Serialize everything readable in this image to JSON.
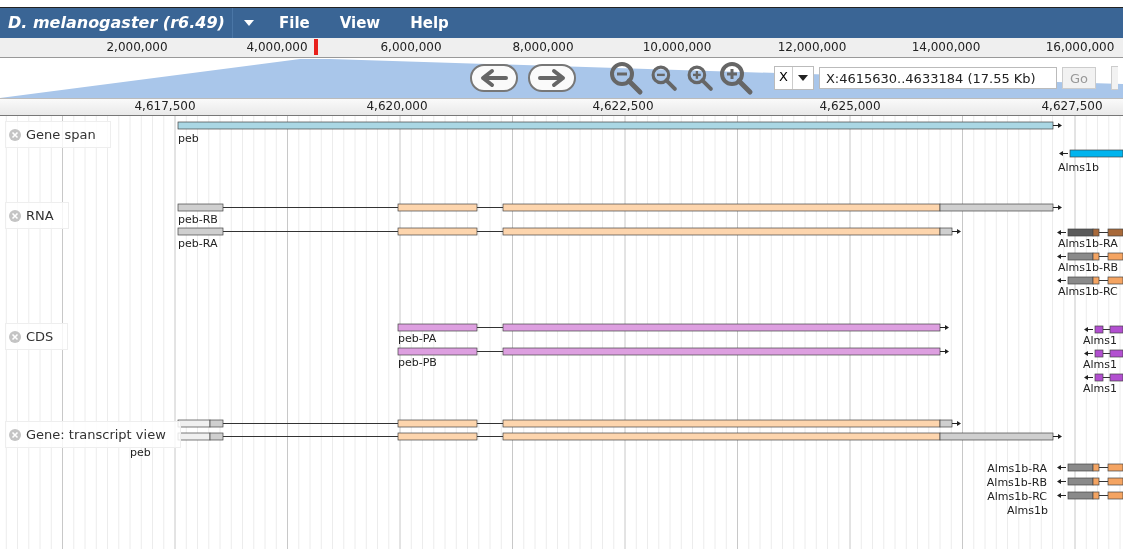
{
  "menu_bar": {
    "title": "D. melanogaster (r6.49)",
    "menus": [
      "File",
      "View",
      "Help"
    ]
  },
  "overview": {
    "ticks": [
      "2,000,000",
      "4,000,000",
      "6,000,000",
      "8,000,000",
      "10,000,000",
      "12,000,000",
      "14,000,000",
      "16,000,000"
    ]
  },
  "navigation": {
    "chromosome": "X",
    "location": "X:4615630..4633184 (17.55 Kb)",
    "go": "Go"
  },
  "ruler": {
    "ticks": [
      "4,617,500",
      "4,620,000",
      "4,622,500",
      "4,625,000",
      "4,627,500"
    ]
  },
  "tracks": [
    {
      "kind": "span",
      "label": "Gene span",
      "features": [
        {
          "label": "peb"
        },
        {
          "label": "Alms1b"
        }
      ]
    },
    {
      "kind": "rna",
      "label": "RNA",
      "features": [
        {
          "label": "peb-RB"
        },
        {
          "label": "peb-RA"
        },
        {
          "label": "Alms1b-RA"
        },
        {
          "label": "Alms1b-RB"
        },
        {
          "label": "Alms1b-RC"
        }
      ]
    },
    {
      "kind": "cds",
      "label": "CDS",
      "features": [
        {
          "label": "peb-PA"
        },
        {
          "label": "peb-PB"
        },
        {
          "label": "Alms1"
        },
        {
          "label": "Alms1"
        },
        {
          "label": "Alms1"
        }
      ]
    },
    {
      "kind": "gene",
      "label": "Gene: transcript view",
      "features": [
        {
          "label": "peb"
        },
        {
          "label": "Alms1b-RA"
        },
        {
          "label": "Alms1b-RB"
        },
        {
          "label": "Alms1b-RC"
        },
        {
          "label": "Alms1b"
        }
      ]
    }
  ]
}
